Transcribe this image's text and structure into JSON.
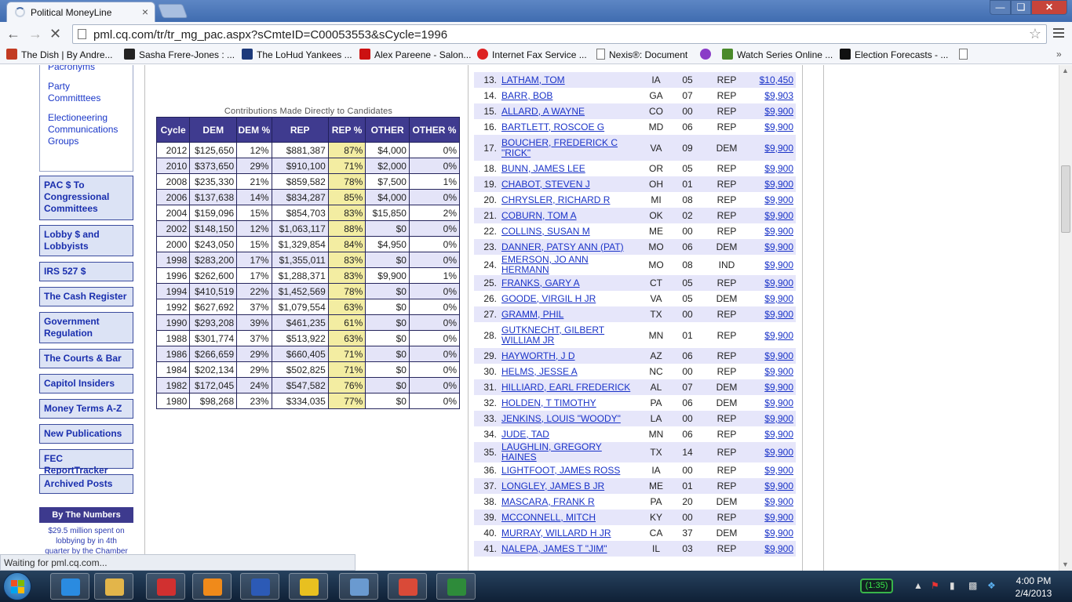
{
  "browser": {
    "tab_title": "Political MoneyLine",
    "tab_close": "×",
    "url": "pml.cq.com/tr/tr_mg_pac.aspx?sCmteID=C00053553&sCycle=1996",
    "bookmarks": [
      {
        "label": "The Dish | By Andre...",
        "color": "#c23b22"
      },
      {
        "label": "Sasha Frere-Jones : ...",
        "color": "#222222"
      },
      {
        "label": "The LoHud Yankees ...",
        "color": "#1d3a7a"
      },
      {
        "label": "Alex Pareene - Salon...",
        "color": "#cc1111"
      },
      {
        "label": "Internet Fax Service ...",
        "color": "#dd2222"
      },
      {
        "label": "Nexis®: Document",
        "color": "#777777"
      },
      {
        "label": "Watch Series Online ...",
        "color": "#8a3cc7"
      },
      {
        "label": "Watch Series Online ...",
        "color": "#4a8a2a"
      },
      {
        "label": "Election Forecasts - ...",
        "color": "#111111"
      }
    ],
    "status_text": "Waiting for pml.cq.com..."
  },
  "left_nav": {
    "box_links": [
      "Pacronyms",
      "Party Committtees",
      "Electioneering Communications Groups"
    ],
    "buttons": [
      "PAC $ To Congressional Committees",
      "Lobby $ and Lobbyists",
      "IRS 527 $",
      "The Cash Register",
      "Government Regulation",
      "The Courts & Bar",
      "Capitol Insiders",
      "Money Terms A-Z",
      "New Publications",
      "FEC ReportTracker",
      "Archived Posts"
    ],
    "by_the_numbers": "By The Numbers",
    "by_the_numbers_text": "$29.5 million spent on lobbying by in 4th quarter by the Chamber"
  },
  "contributions": {
    "title": "Contributions Made Directly to Candidates",
    "headers": [
      "Cycle",
      "DEM",
      "DEM %",
      "REP",
      "REP %",
      "OTHER",
      "OTHER %"
    ],
    "rows": [
      [
        "2012",
        "$125,650",
        "12%",
        "$881,387",
        "87%",
        "$4,000",
        "0%"
      ],
      [
        "2010",
        "$373,650",
        "29%",
        "$910,100",
        "71%",
        "$2,000",
        "0%"
      ],
      [
        "2008",
        "$235,330",
        "21%",
        "$859,582",
        "78%",
        "$7,500",
        "1%"
      ],
      [
        "2006",
        "$137,638",
        "14%",
        "$834,287",
        "85%",
        "$4,000",
        "0%"
      ],
      [
        "2004",
        "$159,096",
        "15%",
        "$854,703",
        "83%",
        "$15,850",
        "2%"
      ],
      [
        "2002",
        "$148,150",
        "12%",
        "$1,063,117",
        "88%",
        "$0",
        "0%"
      ],
      [
        "2000",
        "$243,050",
        "15%",
        "$1,329,854",
        "84%",
        "$4,950",
        "0%"
      ],
      [
        "1998",
        "$283,200",
        "17%",
        "$1,355,011",
        "83%",
        "$0",
        "0%"
      ],
      [
        "1996",
        "$262,600",
        "17%",
        "$1,288,371",
        "83%",
        "$9,900",
        "1%"
      ],
      [
        "1994",
        "$410,519",
        "22%",
        "$1,452,569",
        "78%",
        "$0",
        "0%"
      ],
      [
        "1992",
        "$627,692",
        "37%",
        "$1,079,554",
        "63%",
        "$0",
        "0%"
      ],
      [
        "1990",
        "$293,208",
        "39%",
        "$461,235",
        "61%",
        "$0",
        "0%"
      ],
      [
        "1988",
        "$301,774",
        "37%",
        "$513,922",
        "63%",
        "$0",
        "0%"
      ],
      [
        "1986",
        "$266,659",
        "29%",
        "$660,405",
        "71%",
        "$0",
        "0%"
      ],
      [
        "1984",
        "$202,134",
        "29%",
        "$502,825",
        "71%",
        "$0",
        "0%"
      ],
      [
        "1982",
        "$172,045",
        "24%",
        "$547,582",
        "76%",
        "$0",
        "0%"
      ],
      [
        "1980",
        "$98,268",
        "23%",
        "$334,035",
        "77%",
        "$0",
        "0%"
      ]
    ]
  },
  "candidates": [
    {
      "num": "13.",
      "name": "LATHAM, TOM",
      "st": "IA",
      "dist": "05",
      "party": "REP",
      "amt": "$10,450"
    },
    {
      "num": "14.",
      "name": "BARR, BOB",
      "st": "GA",
      "dist": "07",
      "party": "REP",
      "amt": "$9,903"
    },
    {
      "num": "15.",
      "name": "ALLARD, A WAYNE",
      "st": "CO",
      "dist": "00",
      "party": "REP",
      "amt": "$9,900"
    },
    {
      "num": "16.",
      "name": "BARTLETT, ROSCOE G",
      "st": "MD",
      "dist": "06",
      "party": "REP",
      "amt": "$9,900"
    },
    {
      "num": "17.",
      "name": "BOUCHER, FREDERICK C \"RICK\"",
      "st": "VA",
      "dist": "09",
      "party": "DEM",
      "amt": "$9,900"
    },
    {
      "num": "18.",
      "name": "BUNN, JAMES LEE",
      "st": "OR",
      "dist": "05",
      "party": "REP",
      "amt": "$9,900"
    },
    {
      "num": "19.",
      "name": "CHABOT, STEVEN J",
      "st": "OH",
      "dist": "01",
      "party": "REP",
      "amt": "$9,900"
    },
    {
      "num": "20.",
      "name": "CHRYSLER, RICHARD R",
      "st": "MI",
      "dist": "08",
      "party": "REP",
      "amt": "$9,900"
    },
    {
      "num": "21.",
      "name": "COBURN, TOM A",
      "st": "OK",
      "dist": "02",
      "party": "REP",
      "amt": "$9,900"
    },
    {
      "num": "22.",
      "name": "COLLINS, SUSAN M",
      "st": "ME",
      "dist": "00",
      "party": "REP",
      "amt": "$9,900"
    },
    {
      "num": "23.",
      "name": "DANNER, PATSY ANN (PAT)",
      "st": "MO",
      "dist": "06",
      "party": "DEM",
      "amt": "$9,900"
    },
    {
      "num": "24.",
      "name": "EMERSON, JO ANN HERMANN",
      "st": "MO",
      "dist": "08",
      "party": "IND",
      "amt": "$9,900"
    },
    {
      "num": "25.",
      "name": "FRANKS, GARY A",
      "st": "CT",
      "dist": "05",
      "party": "REP",
      "amt": "$9,900"
    },
    {
      "num": "26.",
      "name": "GOODE, VIRGIL H JR",
      "st": "VA",
      "dist": "05",
      "party": "DEM",
      "amt": "$9,900"
    },
    {
      "num": "27.",
      "name": "GRAMM, PHIL",
      "st": "TX",
      "dist": "00",
      "party": "REP",
      "amt": "$9,900"
    },
    {
      "num": "28.",
      "name": "GUTKNECHT, GILBERT WILLIAM JR",
      "st": "MN",
      "dist": "01",
      "party": "REP",
      "amt": "$9,900"
    },
    {
      "num": "29.",
      "name": "HAYWORTH, J D",
      "st": "AZ",
      "dist": "06",
      "party": "REP",
      "amt": "$9,900"
    },
    {
      "num": "30.",
      "name": "HELMS, JESSE A",
      "st": "NC",
      "dist": "00",
      "party": "REP",
      "amt": "$9,900"
    },
    {
      "num": "31.",
      "name": "HILLIARD, EARL FREDERICK",
      "st": "AL",
      "dist": "07",
      "party": "DEM",
      "amt": "$9,900"
    },
    {
      "num": "32.",
      "name": "HOLDEN, T TIMOTHY",
      "st": "PA",
      "dist": "06",
      "party": "DEM",
      "amt": "$9,900"
    },
    {
      "num": "33.",
      "name": "JENKINS, LOUIS \"WOODY\"",
      "st": "LA",
      "dist": "00",
      "party": "REP",
      "amt": "$9,900"
    },
    {
      "num": "34.",
      "name": "JUDE, TAD",
      "st": "MN",
      "dist": "06",
      "party": "REP",
      "amt": "$9,900"
    },
    {
      "num": "35.",
      "name": "LAUGHLIN, GREGORY HAINES",
      "st": "TX",
      "dist": "14",
      "party": "REP",
      "amt": "$9,900"
    },
    {
      "num": "36.",
      "name": "LIGHTFOOT, JAMES ROSS",
      "st": "IA",
      "dist": "00",
      "party": "REP",
      "amt": "$9,900"
    },
    {
      "num": "37.",
      "name": "LONGLEY, JAMES B JR",
      "st": "ME",
      "dist": "01",
      "party": "REP",
      "amt": "$9,900"
    },
    {
      "num": "38.",
      "name": "MASCARA, FRANK R",
      "st": "PA",
      "dist": "20",
      "party": "DEM",
      "amt": "$9,900"
    },
    {
      "num": "39.",
      "name": "MCCONNELL, MITCH",
      "st": "KY",
      "dist": "00",
      "party": "REP",
      "amt": "$9,900"
    },
    {
      "num": "40.",
      "name": "MURRAY, WILLARD H JR",
      "st": "CA",
      "dist": "37",
      "party": "DEM",
      "amt": "$9,900"
    },
    {
      "num": "41.",
      "name": "NALEPA, JAMES T \"JIM\"",
      "st": "IL",
      "dist": "03",
      "party": "REP",
      "amt": "$9,900"
    }
  ],
  "taskbar": {
    "apps": [
      {
        "name": "ie-icon",
        "color": "#2a8be0"
      },
      {
        "name": "explorer-icon",
        "color": "#e3b54a"
      },
      {
        "name": "app-red-icon",
        "color": "#d13030"
      },
      {
        "name": "media-icon",
        "color": "#f08a1a"
      },
      {
        "name": "word-icon",
        "color": "#2c5ab6"
      },
      {
        "name": "gtalk-icon",
        "color": "#e8c020"
      },
      {
        "name": "network-icon",
        "color": "#6a9ad0"
      },
      {
        "name": "chrome-icon",
        "color": "#d94a38"
      },
      {
        "name": "excel-icon",
        "color": "#2e8b3a"
      }
    ],
    "battery": "(1:35)",
    "time": "4:00 PM",
    "date": "2/4/2013"
  }
}
